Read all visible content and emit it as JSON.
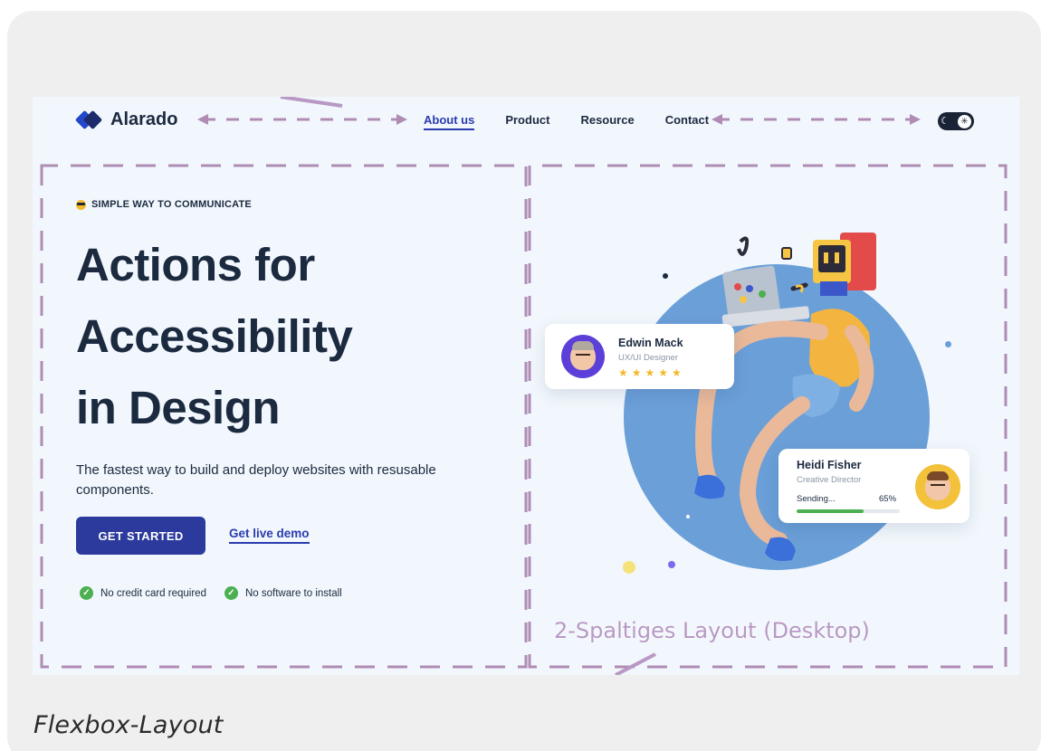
{
  "header": {
    "logo_text": "Alarado",
    "nav": [
      "About us",
      "Product",
      "Resource",
      "Contact"
    ],
    "toggle_icons": [
      "moon-icon",
      "sun-icon"
    ]
  },
  "hero": {
    "kicker": "SIMPLE WAY TO COMMUNICATE",
    "headline": [
      "Actions for",
      "Accessibility",
      "in Design"
    ],
    "subtitle": "The fastest way to build and deploy websites with resusable components.",
    "cta_primary": "GET STARTED",
    "cta_secondary": "Get live demo",
    "checks": [
      "No credit card required",
      "No software to install"
    ]
  },
  "cards": {
    "edwin": {
      "name": "Edwin Mack",
      "role": "UX/UI Designer",
      "stars": "★★★★★",
      "rating": 5
    },
    "heidi": {
      "name": "Heidi Fisher",
      "role": "Creative Director",
      "status": "Sending...",
      "progress_label": "65%",
      "progress": 0.65
    }
  },
  "annotation": "2-Spaltiges Layout (Desktop)",
  "caption": "Flexbox-Layout",
  "colors": {
    "primary": "#2b3a9c",
    "text": "#1c2a40",
    "accent_green": "#4caf50",
    "circle": "#6b9fd8",
    "dashed": "#b08cb5"
  }
}
